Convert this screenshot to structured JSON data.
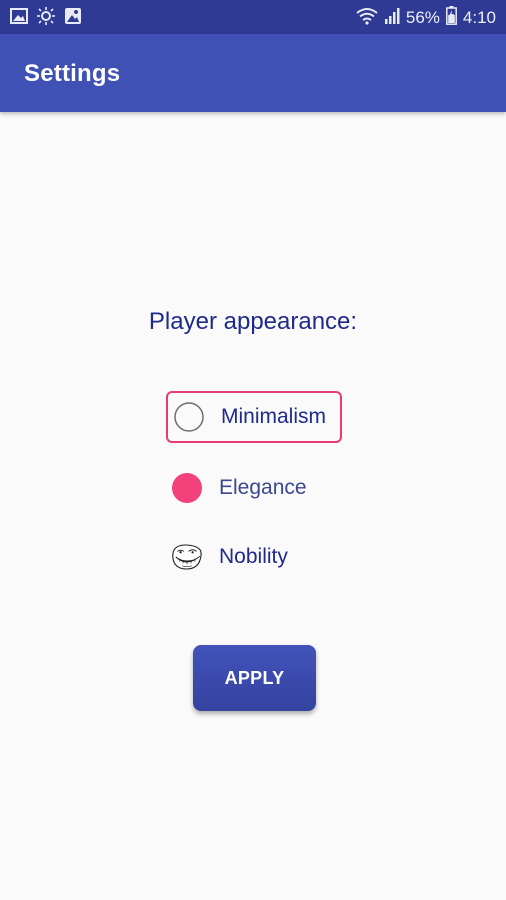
{
  "status_bar": {
    "battery": "56%",
    "time": "4:10",
    "left_icons": [
      "image-icon",
      "brightness-icon",
      "photo-icon"
    ],
    "right_icons": [
      "wifi-icon",
      "signal-icon",
      "battery-icon"
    ]
  },
  "app_bar": {
    "title": "Settings"
  },
  "main": {
    "section_title": "Player appearance:",
    "options": [
      {
        "label": "Minimalism",
        "icon": "empty-circle-icon",
        "focused": true
      },
      {
        "label": "Elegance",
        "icon": "pink-filled-circle-icon",
        "focused": false
      },
      {
        "label": "Nobility",
        "icon": "troll-face-icon",
        "focused": false
      }
    ],
    "apply_label": "APPLY"
  },
  "colors": {
    "primary": "#3f51b5",
    "primary_dark": "#2e3a94",
    "accent": "#f2417b",
    "text": "#1f2a8c"
  }
}
